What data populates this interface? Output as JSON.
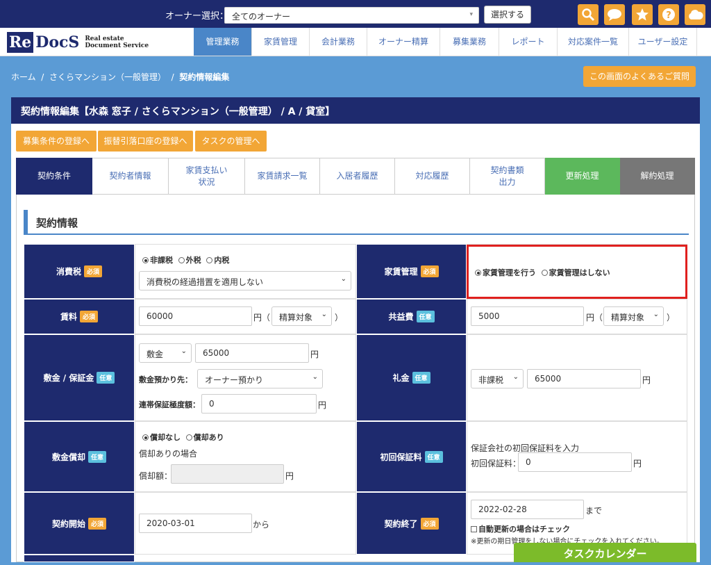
{
  "topbar": {
    "owner_label": "オーナー選択：",
    "owner_select_value": "全てのオーナー",
    "select_button": "選択する",
    "icons": [
      "search-icon",
      "chat-icon",
      "star-icon",
      "help-icon",
      "cloud-icon"
    ]
  },
  "logo": {
    "re": "Re",
    "docs": "DocS",
    "sub1": "Real estate",
    "sub2": "Document Service"
  },
  "nav": [
    "管理業務",
    "家賃管理",
    "会計業務",
    "オーナー精算",
    "募集業務",
    "レポート",
    "対応案件一覧",
    "ユーザー設定"
  ],
  "breadcrumb": {
    "home": "ホーム",
    "sep": "/",
    "property": "さくらマンション（一般管理）",
    "current": "契約情報編集"
  },
  "faq_button": "この画面のよくあるご質問",
  "panel_title": "契約情報編集【水森 窓子 / さくらマンション（一般管理） / A / 貸室】",
  "quick_buttons": [
    "募集条件の登録へ",
    "振替引落口座の登録へ",
    "タスクの管理へ"
  ],
  "tabs": [
    {
      "label": "契約条件"
    },
    {
      "label": "契約者情報"
    },
    {
      "label": "家賃支払い\n状況"
    },
    {
      "label": "家賃請求一覧"
    },
    {
      "label": "入居者履歴"
    },
    {
      "label": "対応履歴"
    },
    {
      "label": "契約書類\n出力"
    },
    {
      "label": "更新処理"
    },
    {
      "label": "解約処理"
    }
  ],
  "section_title": "契約情報",
  "badges": {
    "required": "必須",
    "optional": "任意"
  },
  "form": {
    "tax": {
      "label": "消費税",
      "options": [
        "非課税",
        "外税",
        "内税"
      ],
      "select": "消費税の経過措置を適用しない"
    },
    "rent_mgmt": {
      "label": "家賃管理",
      "options": [
        "家賃管理を行う",
        "家賃管理はしない"
      ]
    },
    "rent": {
      "label": "賃料",
      "value": "60000",
      "unit": "円（",
      "select": "精算対象",
      "close": "）"
    },
    "common": {
      "label": "共益費",
      "value": "5000",
      "unit": "円（",
      "select": "精算対象",
      "close": "）"
    },
    "deposit": {
      "label": "敷金 / 保証金",
      "type": "敷金",
      "value": "65000",
      "unit": "円",
      "holder_label": "敷金預かり先：",
      "holder": "オーナー預かり",
      "guarantee_label": "連帯保証極度額：",
      "guarantee": "0",
      "guarantee_unit": "円"
    },
    "key_money": {
      "label": "礼金",
      "tax": "非課税",
      "value": "65000",
      "unit": "円"
    },
    "amortize": {
      "label": "敷金償却",
      "options": [
        "償却なし",
        "償却あり"
      ],
      "note": "償却ありの場合",
      "amount_label": "償却額：",
      "amount": "",
      "unit": "円"
    },
    "first_guarantee": {
      "label": "初回保証料",
      "note": "保証会社の初回保証料を入力",
      "field_label": "初回保証料：",
      "value": "0",
      "unit": "円"
    },
    "start": {
      "label": "契約開始",
      "value": "2020-03-01",
      "suffix": "から"
    },
    "end": {
      "label": "契約終了",
      "value": "2022-02-28",
      "suffix": "まで",
      "auto": "自動更新の場合はチェック",
      "note": "※更新の期日管理をしない場合にチェックを入れてください。"
    }
  },
  "task_calendar": "タスクカレンダー",
  "colors": {
    "navy": "#1e2a6e",
    "orange": "#f2a636",
    "blue": "#4a86c8",
    "green": "#5cb85c",
    "highlight": "#e0201e"
  }
}
